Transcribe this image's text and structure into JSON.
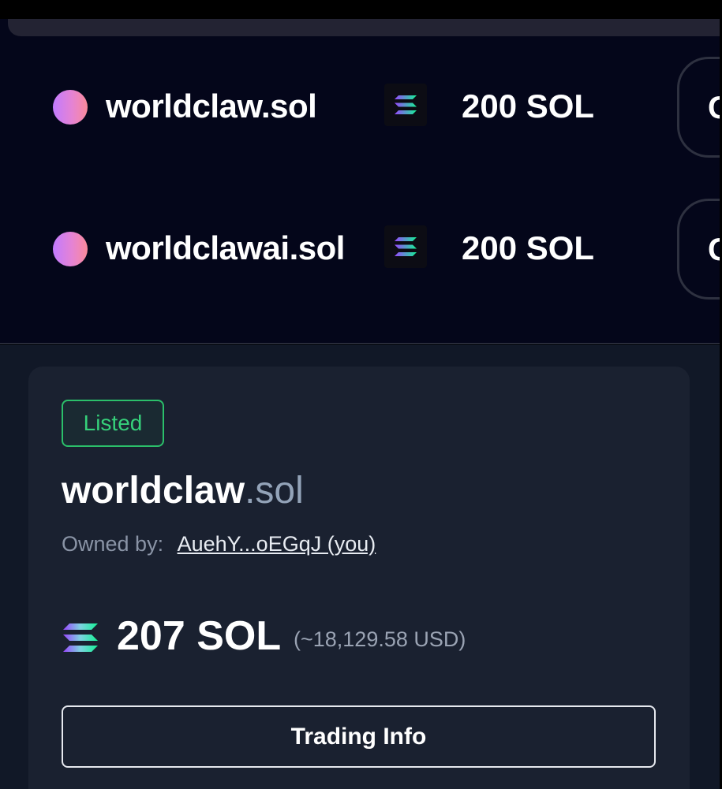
{
  "listings": [
    {
      "domain": "worldclaw.sol",
      "price": "200 SOL",
      "button_label_partial": "C"
    },
    {
      "domain": "worldclawai.sol",
      "price": "200 SOL",
      "button_label_partial": "C"
    }
  ],
  "detail": {
    "status_badge": "Listed",
    "domain_name": "worldclaw",
    "domain_tld": ".sol",
    "owner_label": "Owned by:",
    "owner_address": "AuehY...oEGqJ (you)",
    "price": "207 SOL",
    "price_usd": "(~18,129.58 USD)",
    "trading_info_button": "Trading Info"
  },
  "icons": {
    "listing_dot": "domain-avatar-icon",
    "currency": "solana-icon"
  },
  "colors": {
    "listed_green": "#36d07a",
    "panel_dark": "#04061a",
    "card_bg": "#1a2130",
    "tld_gray": "#93a3b8"
  }
}
